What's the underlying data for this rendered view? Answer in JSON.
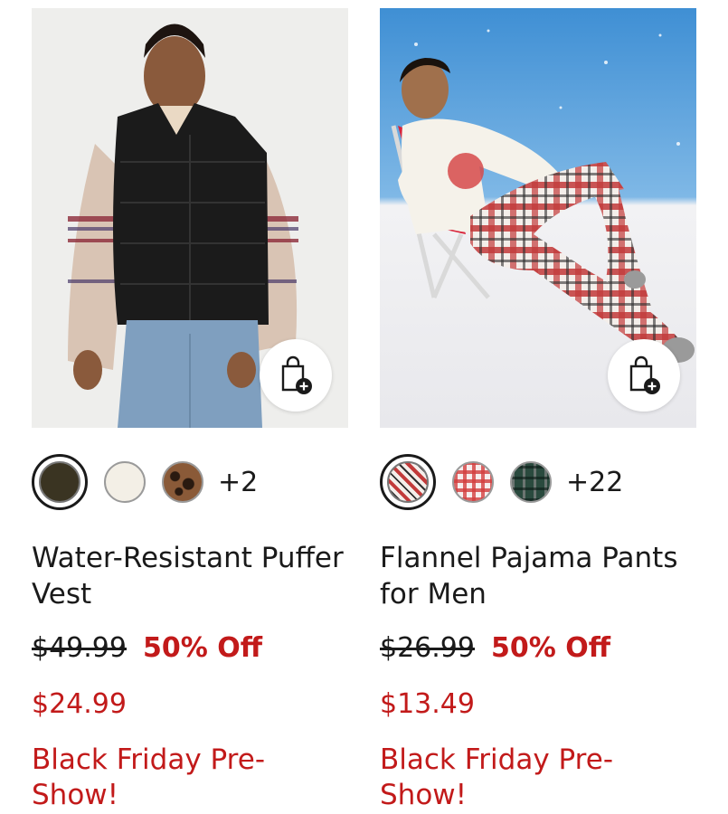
{
  "products": [
    {
      "name": "Water-Resistant Puffer Vest",
      "image_alt": "Woman wearing black puffer vest over fair isle sweater",
      "add_to_bag_icon": "shopping-bag-plus-icon",
      "swatches": [
        {
          "name": "black",
          "color": "#3a3422",
          "selected": true
        },
        {
          "name": "cream",
          "color": "#f3efe6",
          "selected": false
        },
        {
          "name": "leopard",
          "color": "#7a4b2c",
          "selected": false
        }
      ],
      "more_colors": "+2",
      "original_price": "$49.99",
      "discount": "50% Off",
      "sale_price": "$24.99",
      "promo": "Black Friday Pre-Show!"
    },
    {
      "name": "Flannel Pajama Pants for Men",
      "image_alt": "Man in plaid pajama pants sitting on beach chair in snow",
      "add_to_bag_icon": "shopping-bag-plus-icon",
      "swatches": [
        {
          "name": "red-plaid",
          "color": "#c23a3a",
          "selected": true
        },
        {
          "name": "red-white-plaid",
          "color": "#d94a4a",
          "selected": false
        },
        {
          "name": "green-plaid",
          "color": "#1f3b33",
          "selected": false
        }
      ],
      "more_colors": "+22",
      "original_price": "$26.99",
      "discount": "50% Off",
      "sale_price": "$13.49",
      "promo": "Black Friday Pre-Show!"
    }
  ],
  "colors": {
    "sale_red": "#c21a1a",
    "text": "#1a1a1a"
  }
}
